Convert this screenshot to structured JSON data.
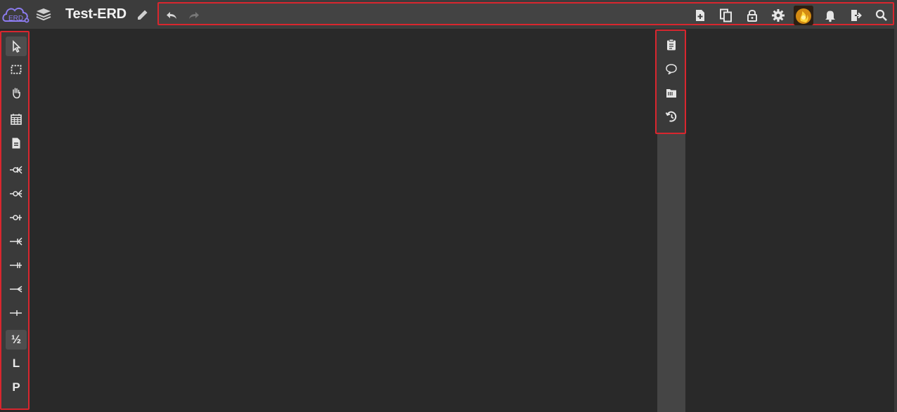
{
  "app": {
    "logo_text": "ERD",
    "title": "Test-ERD"
  },
  "toolbar": {
    "left_icons": [
      "undo-icon",
      "redo-icon"
    ],
    "right_icons": [
      "new-file-icon",
      "copy-icon",
      "lock-icon",
      "gear-icon",
      "avatar",
      "bell-icon",
      "logout-icon",
      "search-icon"
    ]
  },
  "left_tools": [
    {
      "name": "select-pointer",
      "icon": "pointer-icon"
    },
    {
      "name": "rect-select",
      "icon": "marquee-icon"
    },
    {
      "name": "hand-pan",
      "icon": "hand-icon"
    },
    {
      "name": "table-tool",
      "icon": "table-icon"
    },
    {
      "name": "memo-tool",
      "icon": "document-icon"
    },
    {
      "name": "rel-zero-or-many",
      "icon": "rel-zero-many-icon"
    },
    {
      "name": "rel-zero-or-one-many",
      "icon": "rel-zero-one-many-icon"
    },
    {
      "name": "rel-zero-or-one",
      "icon": "rel-zero-one-icon"
    },
    {
      "name": "rel-one-or-many",
      "icon": "rel-one-many-icon"
    },
    {
      "name": "rel-one-only",
      "icon": "rel-one-only-icon"
    },
    {
      "name": "rel-many",
      "icon": "rel-many-icon"
    },
    {
      "name": "rel-one",
      "icon": "rel-one-icon"
    },
    {
      "name": "identifying-toggle",
      "icon": "lp-icon",
      "label": "½"
    },
    {
      "name": "logical-mode",
      "icon": "l-icon",
      "label": "L"
    },
    {
      "name": "physical-mode",
      "icon": "p-icon",
      "label": "P"
    }
  ],
  "right_tools": [
    "clipboard-icon",
    "comment-icon",
    "folder-icon",
    "history-icon"
  ],
  "colors": {
    "highlight": "#d9262e",
    "icon": "#e6e6e6",
    "canvas": "#292929",
    "logo": "#8c7cf0"
  }
}
